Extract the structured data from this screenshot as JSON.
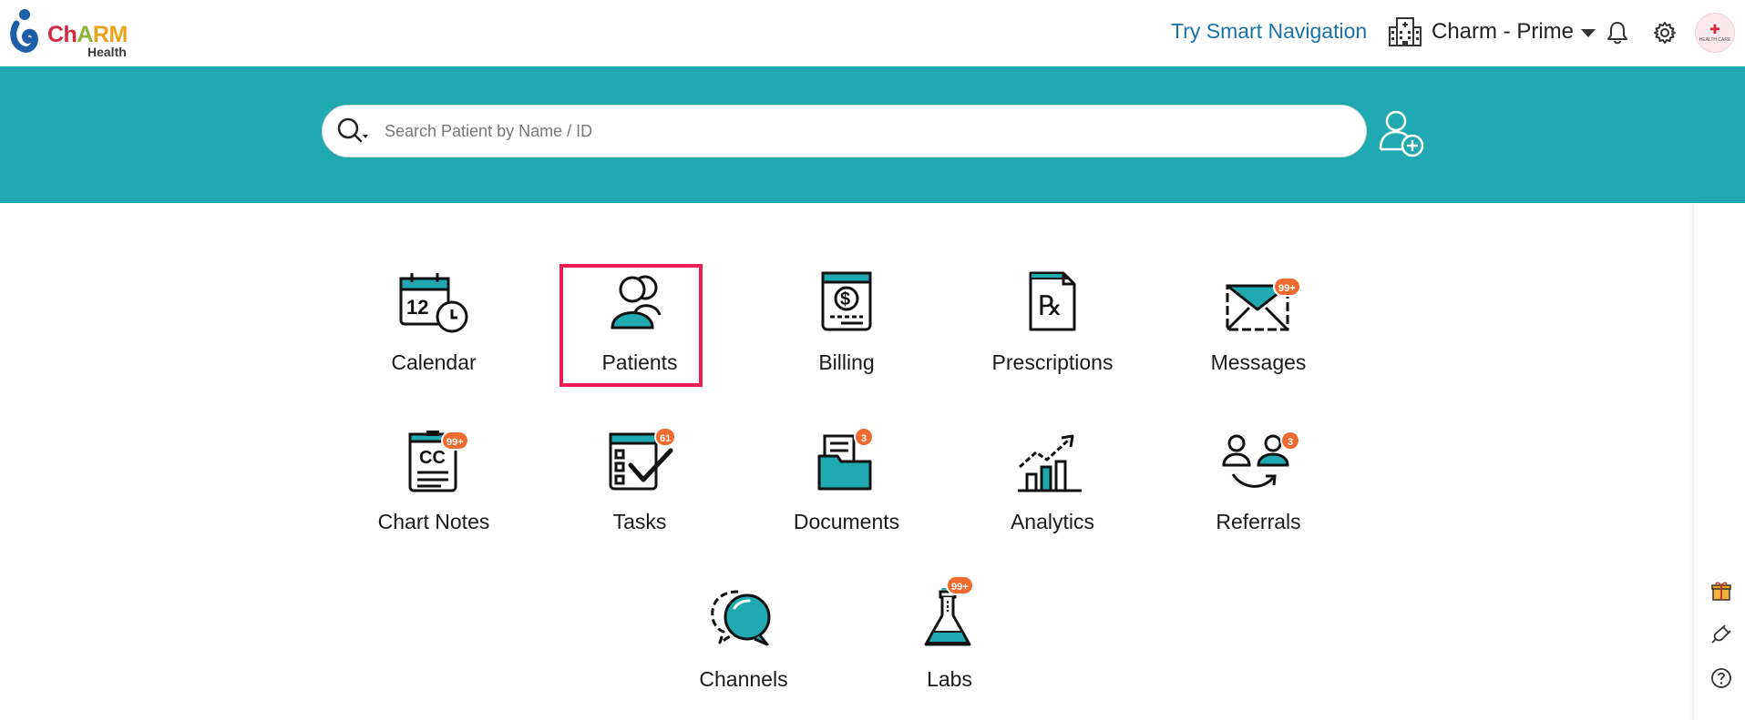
{
  "brand": {
    "logo_text_1": "Ch",
    "logo_text_2": "A",
    "logo_text_3": "RM",
    "logo_sub": "Health"
  },
  "header": {
    "try_nav": "Try Smart Navigation",
    "org_name": "Charm - Prime",
    "avatar_cross": "✚",
    "avatar_text": "HEALTH CARE"
  },
  "search": {
    "placeholder": "Search Patient by Name / ID"
  },
  "colors": {
    "teal": "#21a9b1",
    "badge": "#ef6a2e",
    "highlight": "#ec1c55",
    "link": "#1a73a8"
  },
  "modules": [
    {
      "label": "Calendar",
      "icon": "calendar-icon",
      "badge": ""
    },
    {
      "label": "Patients",
      "icon": "patients-icon",
      "badge": ""
    },
    {
      "label": "Billing",
      "icon": "billing-icon",
      "badge": ""
    },
    {
      "label": "Prescriptions",
      "icon": "prescriptions-icon",
      "badge": ""
    },
    {
      "label": "Messages",
      "icon": "messages-icon",
      "badge": "99+"
    },
    {
      "label": "Chart Notes",
      "icon": "chart-notes-icon",
      "badge": "99+"
    },
    {
      "label": "Tasks",
      "icon": "tasks-icon",
      "badge": "61"
    },
    {
      "label": "Documents",
      "icon": "documents-icon",
      "badge": "3"
    },
    {
      "label": "Analytics",
      "icon": "analytics-icon",
      "badge": ""
    },
    {
      "label": "Referrals",
      "icon": "referrals-icon",
      "badge": "3"
    },
    {
      "label": "Channels",
      "icon": "channels-icon",
      "badge": ""
    },
    {
      "label": "Labs",
      "icon": "labs-icon",
      "badge": "99+"
    }
  ],
  "calendar_day": "12",
  "billing_symbol": "$",
  "rx_symbol": "℞",
  "chart_notes_text": "CC",
  "rail": [
    "gift-icon",
    "plug-icon",
    "help-icon"
  ]
}
